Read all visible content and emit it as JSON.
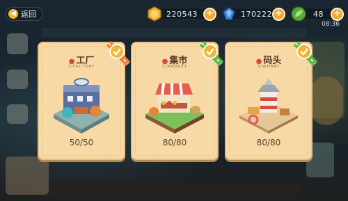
{
  "header": {
    "back_label": "返回",
    "coins": "220543",
    "gems": "170222",
    "energy": "48",
    "energy_timer": "08:36"
  },
  "colors": {
    "card_bg": "#f7d9a6",
    "pin_red": "#d9493d",
    "badge_gold": "#f2b534",
    "ribbon_green": "#5fb946"
  },
  "locations": [
    {
      "name": "工厂",
      "subtitle": "1/FACTORY",
      "progress": "50/50",
      "ribbon": "orange"
    },
    {
      "name": "集市",
      "subtitle": "2/MARKET",
      "progress": "80/80",
      "ribbon": "green"
    },
    {
      "name": "码头",
      "subtitle": "3/WHART",
      "progress": "80/80",
      "ribbon": "green"
    }
  ]
}
